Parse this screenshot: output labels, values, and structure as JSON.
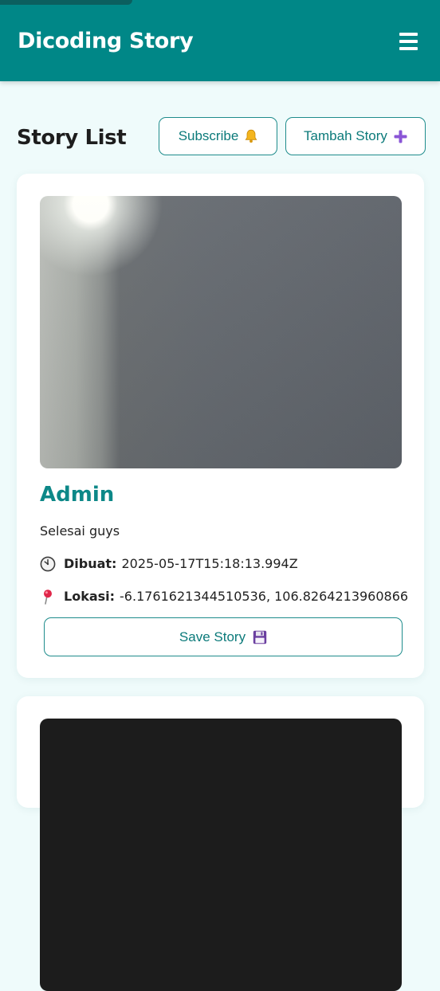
{
  "header": {
    "brand": "Dicoding Story",
    "menu_icon": "hamburger-icon"
  },
  "story_section": {
    "title": "Story List",
    "subscribe_label": "Subscribe",
    "subscribe_icon": "bell-icon",
    "add_label": "Tambah Story",
    "add_icon": "plus-icon"
  },
  "stories": [
    {
      "author": "Admin",
      "description": "Selesai guys",
      "created_label": "Dibuat:",
      "created_value": "2025-05-17T15:18:13.994Z",
      "created_icon": "clock-icon",
      "location_label": "Lokasi:",
      "location_value": "-6.1761621344510536, 106.8264213960866",
      "location_icon": "pin-icon",
      "save_label": "Save Story",
      "save_icon": "floppy-disk-icon"
    }
  ],
  "colors": {
    "brand": "#008787",
    "accent_text": "#0b7a7a",
    "page_background": "#effbfb",
    "plus_icon": "#8a55d6"
  }
}
